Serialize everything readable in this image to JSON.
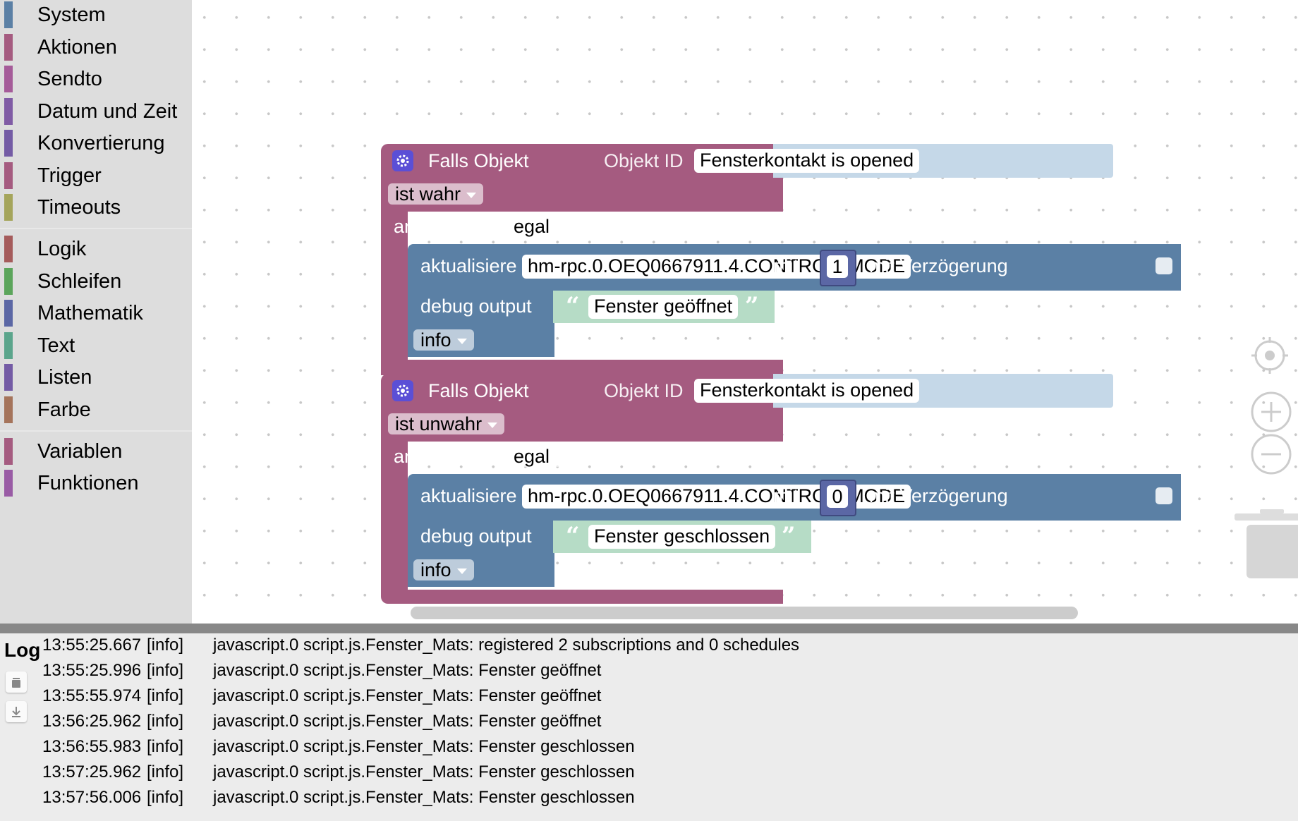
{
  "toolbox": {
    "categories": [
      {
        "label": "System",
        "color": "#5b80a5"
      },
      {
        "label": "Aktionen",
        "color": "#a55b80"
      },
      {
        "label": "Sendto",
        "color": "#a55b99"
      },
      {
        "label": "Datum und Zeit",
        "color": "#805ba5"
      },
      {
        "label": "Konvertierung",
        "color": "#745ba5"
      },
      {
        "label": "Trigger",
        "color": "#a55b80"
      },
      {
        "label": "Timeouts",
        "color": "#a5a55b"
      },
      {
        "label": "Logik",
        "color": "#a55b5b"
      },
      {
        "label": "Schleifen",
        "color": "#5ba55b"
      },
      {
        "label": "Mathematik",
        "color": "#5b67a5"
      },
      {
        "label": "Text",
        "color": "#5ba58c"
      },
      {
        "label": "Listen",
        "color": "#745ba5"
      },
      {
        "label": "Farbe",
        "color": "#a5745b"
      },
      {
        "label": "Variablen",
        "color": "#a55b80"
      },
      {
        "label": "Funktionen",
        "color": "#995ba5"
      }
    ]
  },
  "blocks": [
    {
      "title": "Falls Objekt",
      "object_label": "Objekt ID",
      "object_value": "Fensterkontakt is opened",
      "condition": "ist wahr",
      "ack_label": "anerkannt ist",
      "ack_value": "egal",
      "update_label": "aktualisiere",
      "update_target": "hm-rpc.0.OEQ0667911.4.CONTROL_MODE",
      "with_label": "mit",
      "update_value": "1",
      "delay_label": "mit Verzögerung",
      "debug_label": "debug output",
      "debug_text": "Fenster geöffnet",
      "debug_level": "info"
    },
    {
      "title": "Falls Objekt",
      "object_label": "Objekt ID",
      "object_value": "Fensterkontakt is opened",
      "condition": "ist unwahr",
      "ack_label": "anerkannt ist",
      "ack_value": "egal",
      "update_label": "aktualisiere",
      "update_target": "hm-rpc.0.OEQ0667911.4.CONTROL_MODE",
      "with_label": "mit",
      "update_value": "0",
      "delay_label": "mit Verzögerung",
      "debug_label": "debug output",
      "debug_text": "Fenster geschlossen",
      "debug_level": "info"
    }
  ],
  "icons": {
    "gear": "gear-icon",
    "target": "center-target-icon",
    "zoom_in": "zoom-in-icon",
    "zoom_out": "zoom-out-icon",
    "trash": "trash-icon",
    "log_clear": "trash-icon",
    "log_download": "download-icon"
  },
  "quotes": {
    "open": "“",
    "close": "”"
  },
  "log": {
    "title": "Log",
    "entries": [
      {
        "time": "13:55:25.667",
        "level": "[info]",
        "message": "javascript.0 script.js.Fenster_Mats: registered 2 subscriptions and 0 schedules"
      },
      {
        "time": "13:55:25.996",
        "level": "[info]",
        "message": "javascript.0 script.js.Fenster_Mats: Fenster geöffnet"
      },
      {
        "time": "13:55:55.974",
        "level": "[info]",
        "message": "javascript.0 script.js.Fenster_Mats: Fenster geöffnet"
      },
      {
        "time": "13:56:25.962",
        "level": "[info]",
        "message": "javascript.0 script.js.Fenster_Mats: Fenster geöffnet"
      },
      {
        "time": "13:56:55.983",
        "level": "[info]",
        "message": "javascript.0 script.js.Fenster_Mats: Fenster geschlossen"
      },
      {
        "time": "13:57:25.962",
        "level": "[info]",
        "message": "javascript.0 script.js.Fenster_Mats: Fenster geschlossen"
      },
      {
        "time": "13:57:56.006",
        "level": "[info]",
        "message": "javascript.0 script.js.Fenster_Mats: Fenster geschlossen"
      }
    ]
  }
}
